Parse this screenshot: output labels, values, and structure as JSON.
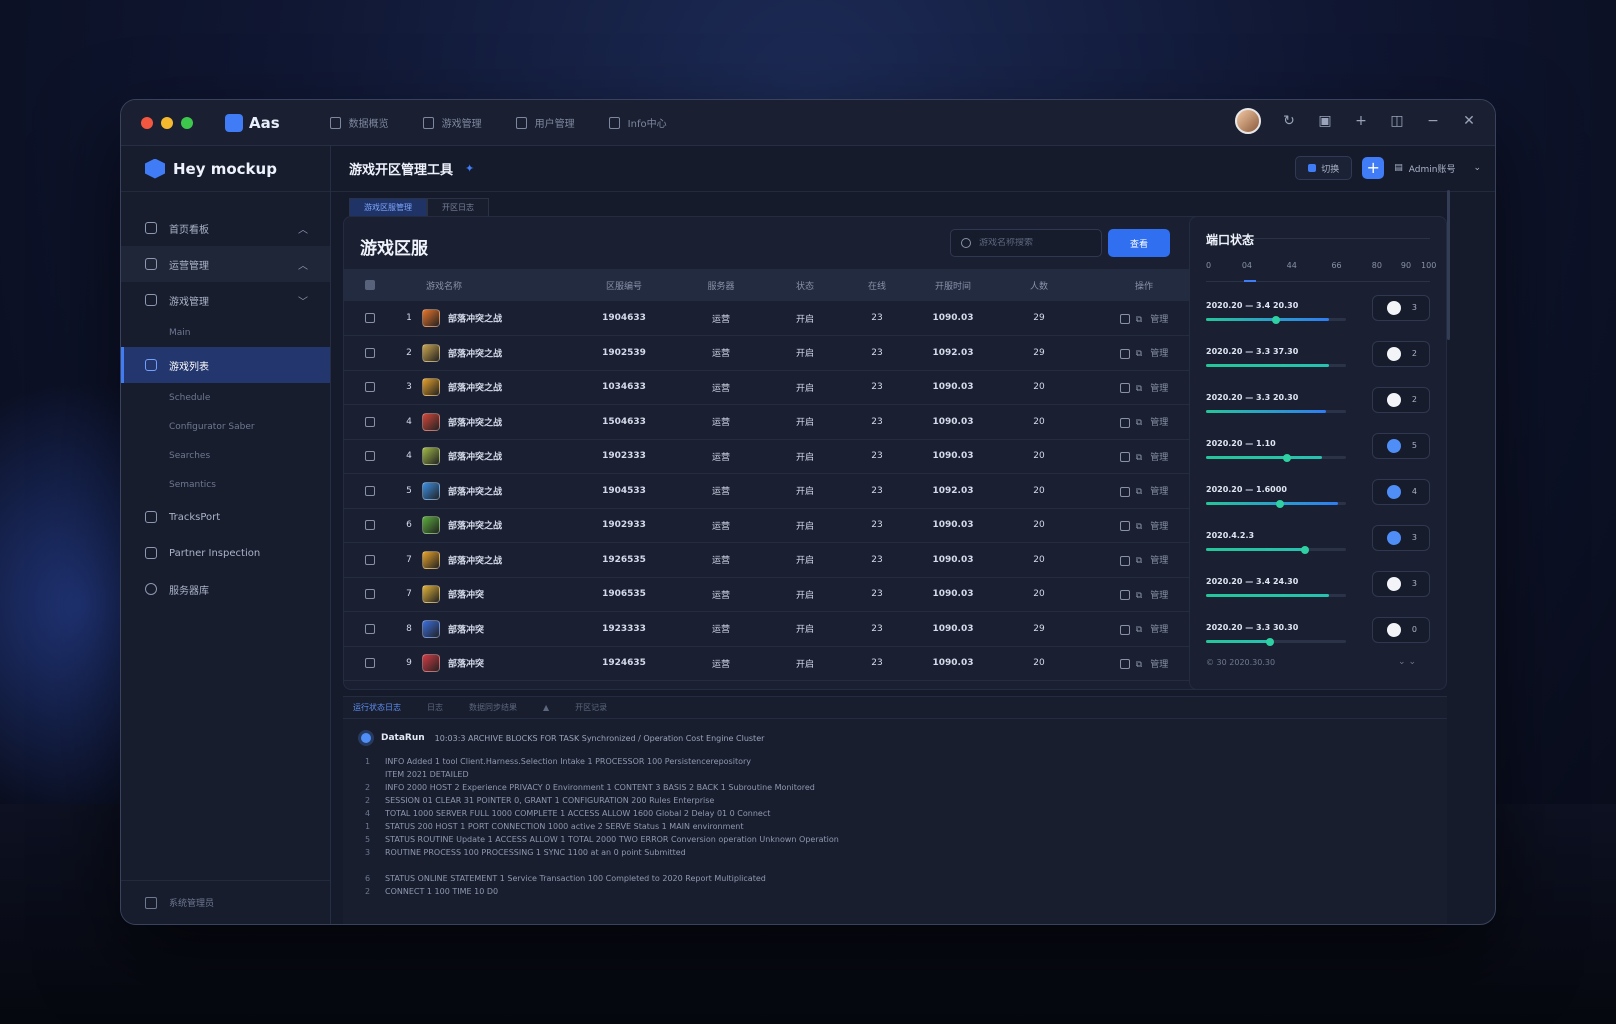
{
  "app": {
    "name": "Aas",
    "brand": "Hey mockup",
    "top_nav": [
      "数据概览",
      "游戏管理",
      "用户管理",
      "Info中心"
    ]
  },
  "sidebar": {
    "items": [
      {
        "label": "首页看板",
        "chevron": "^"
      },
      {
        "label": "运营管理",
        "chevron": "^"
      },
      {
        "label": "游戏管理",
        "chevron": "v"
      },
      {
        "label": "Main"
      },
      {
        "label": "游戏列表"
      },
      {
        "label": "Schedule"
      },
      {
        "label": "Configurator Saber"
      },
      {
        "label": "Searches"
      },
      {
        "label": "Semantics"
      },
      {
        "label": "TracksPort"
      },
      {
        "label": "Partner Inspection"
      },
      {
        "label": "服务器库"
      }
    ],
    "footer": "系统管理员"
  },
  "header": {
    "title": "游戏开区管理工具",
    "btn_label": "切换",
    "select_label": "Admin账号"
  },
  "tabs": [
    "游戏区服管理",
    "开区日志"
  ],
  "table_card": {
    "title": "游戏区服",
    "search_placeholder": "游戏名称搜索",
    "confirm_label": "查看",
    "columns": [
      "",
      "游戏名称",
      "区服编号",
      "服务器",
      "状态",
      "在线",
      "开服时间",
      "人数",
      "操作"
    ],
    "rows": [
      {
        "no": "1",
        "name": "部落冲突之战",
        "code": "1904633",
        "server": "运营",
        "status": "开启",
        "online": "23",
        "time": "1090.03",
        "count": "29",
        "op": "管理",
        "color": "#e8742a"
      },
      {
        "no": "2",
        "name": "部落冲突之战",
        "code": "1902539",
        "server": "运营",
        "status": "开启",
        "online": "23",
        "time": "1092.03",
        "count": "29",
        "op": "管理",
        "color": "#c9a54e"
      },
      {
        "no": "3",
        "name": "部落冲突之战",
        "code": "1034633",
        "server": "运营",
        "status": "开启",
        "online": "23",
        "time": "1090.03",
        "count": "20",
        "op": "管理",
        "color": "#e4a02a"
      },
      {
        "no": "4",
        "name": "部落冲突之战",
        "code": "1504633",
        "server": "运营",
        "status": "开启",
        "online": "23",
        "time": "1090.03",
        "count": "20",
        "op": "管理",
        "color": "#d4463a"
      },
      {
        "no": "4",
        "name": "部落冲突之战",
        "code": "1902333",
        "server": "运营",
        "status": "开启",
        "online": "23",
        "time": "1090.03",
        "count": "20",
        "op": "管理",
        "color": "#9fb846"
      },
      {
        "no": "5",
        "name": "部落冲突之战",
        "code": "1904533",
        "server": "运营",
        "status": "开启",
        "online": "23",
        "time": "1092.03",
        "count": "20",
        "op": "管理",
        "color": "#3b8fe6"
      },
      {
        "no": "6",
        "name": "部落冲突之战",
        "code": "1902933",
        "server": "运营",
        "status": "开启",
        "online": "23",
        "time": "1090.03",
        "count": "20",
        "op": "管理",
        "color": "#5aae3b"
      },
      {
        "no": "7",
        "name": "部落冲突之战",
        "code": "1926535",
        "server": "运营",
        "status": "开启",
        "online": "23",
        "time": "1090.03",
        "count": "20",
        "op": "管理",
        "color": "#e8a32a"
      },
      {
        "no": "7",
        "name": "部落冲突",
        "code": "1906535",
        "server": "运营",
        "status": "开启",
        "online": "23",
        "time": "1090.03",
        "count": "20",
        "op": "管理",
        "color": "#e0b23a"
      },
      {
        "no": "8",
        "name": "部落冲突",
        "code": "1923333",
        "server": "运营",
        "status": "开启",
        "online": "23",
        "time": "1090.03",
        "count": "29",
        "op": "管理",
        "color": "#3a6fe0"
      },
      {
        "no": "9",
        "name": "部落冲突",
        "code": "1924635",
        "server": "运营",
        "status": "开启",
        "online": "23",
        "time": "1090.03",
        "count": "20",
        "op": "管理",
        "color": "#d43a45"
      }
    ]
  },
  "panel": {
    "title": "端口状态",
    "scale": [
      "0",
      "04",
      "44",
      "66",
      "80",
      "90",
      "100"
    ],
    "ports": [
      {
        "label": "2020.20 — 3.4 20.30",
        "value": 0.5,
        "fill": 0.88,
        "on": false,
        "num": "3",
        "blue": true
      },
      {
        "label": "2020.20 — 3.3 37.30",
        "value": null,
        "fill": 0.88,
        "on": false,
        "num": "2",
        "blue": false
      },
      {
        "label": "2020.20 — 3.3 20.30",
        "value": null,
        "fill": 0.86,
        "on": false,
        "num": "2",
        "blue": true
      },
      {
        "label": "2020.20 — 1.10",
        "value": 0.58,
        "fill": 0.83,
        "on": true,
        "num": "5",
        "blue": false
      },
      {
        "label": "2020.20 — 1.6000",
        "value": 0.53,
        "fill": 0.94,
        "on": true,
        "num": "4",
        "blue": true
      },
      {
        "label": "2020.4.2.3",
        "value": 0.71,
        "fill": 0.71,
        "on": true,
        "num": "3",
        "blue": false
      },
      {
        "label": "2020.20 — 3.4 24.30",
        "value": null,
        "fill": 0.88,
        "on": false,
        "num": "3",
        "blue": false
      },
      {
        "label": "2020.20 — 3.3 30.30",
        "value": 0.46,
        "fill": 0.46,
        "on": false,
        "num": "0",
        "blue": false
      }
    ],
    "footer": "© 30 2020.30.30",
    "footer_right": "⌄ ⌄"
  },
  "log": {
    "tabs": [
      "运行状态日志",
      "日志",
      "数据同步结果",
      "▲",
      "开区记录"
    ],
    "head_label": "DataRun",
    "head_msg": "10:03:3 ARCHIVE BLOCKS FOR TASK Synchronized / Operation Cost Engine Cluster",
    "lines": [
      {
        "no": "1",
        "text": "INFO Added 1 tool Client.Harness.Selection Intake 1 PROCESSOR 100 Persistencerepository"
      },
      {
        "no": "",
        "text": "ITEM 2021 DETAILED"
      },
      {
        "no": "2",
        "text": "INFO 2000 HOST 2 Experience PRIVACY 0 Environment 1 CONTENT 3 BASIS 2 BACK 1 Subroutine Monitored"
      },
      {
        "no": "2",
        "text": "SESSION 01 CLEAR 31 POINTER 0, GRANT 1 CONFIGURATION 200 Rules Enterprise"
      },
      {
        "no": "4",
        "text": "TOTAL 1000 SERVER FULL 1000 COMPLETE 1 ACCESS ALLOW 1600 Global 2 Delay 01 0 Connect"
      },
      {
        "no": "1",
        "text": "STATUS 200 HOST 1 PORT CONNECTION 1000 active 2 SERVE Status 1 MAIN environment"
      },
      {
        "no": "5",
        "text": "STATUS ROUTINE Update 1 ACCESS ALLOW 1 TOTAL 2000 TWO ERROR Conversion operation Unknown Operation"
      },
      {
        "no": "3",
        "text": "ROUTINE PROCESS 100 PROCESSING 1 SYNC 1100 at an 0 point Submitted"
      },
      {
        "no": "",
        "text": ""
      },
      {
        "no": "6",
        "text": "STATUS ONLINE STATEMENT 1 Service Transaction 100 Completed to 2020 Report Multiplicated"
      },
      {
        "no": "2",
        "text": "CONNECT 1 100 TIME 10 D0"
      }
    ]
  },
  "colors": {
    "accent": "#3f7cf6",
    "active_bg": "#23366d",
    "slider": "#2fd0a3"
  }
}
